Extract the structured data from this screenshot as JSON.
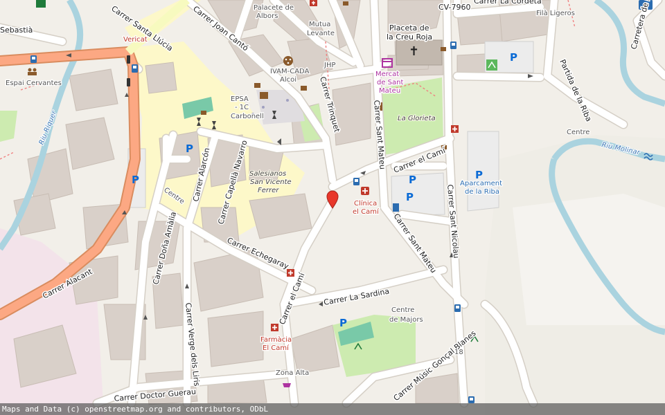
{
  "map": {
    "attribution": "Maps and Data (c) openstreetmap.org and contributors, ODbL",
    "colors": {
      "land": "#f2efe9",
      "road": "#ffffff",
      "road_casing": "#d5cfc6",
      "primary_road": "#fca883",
      "secondary_road": "#f7fabf",
      "pedestrian_area": "#fdf8c9",
      "building": "#d9d0c9",
      "park": "#cdebb0",
      "water": "#aad3df",
      "river": "#6fb8d8",
      "marker": "#e8372a"
    },
    "marker": {
      "name": "location-marker-icon"
    },
    "streets": {
      "carrer_llucia": "Carrer Santa Llúcia",
      "sebastia": "Sebastià",
      "joan_canto": "Carrer Joan Cantó",
      "trinquet": "Carrer Trinquet",
      "sant_mateu_1": "Carrer Sant Mateu",
      "sant_mateu_2": "Carrer Sant Mateu",
      "el_cami_1": "Carrer el Camí",
      "el_cami_2": "Carrer el Camí",
      "sant_nicolau": "Carrer Sant Nicolau",
      "capella_navarro": "Carrer Capellà Navarro",
      "alarcon": "Carrer Alarcón",
      "dona_amalia": "Carrer Doña Amàlia",
      "echegaray": "Carrer Echegaray",
      "verge_lliris": "Carrer Verge dels Liris",
      "la_sardina": "Carrer La Sardina",
      "doctor_guerau": "Carrer Doctor Guerau",
      "music_gonzal": "Carrer Músic Gonçal Blanes",
      "alacant": "Carrer Alacant",
      "partida_riba": "Partida de la Riba",
      "carretera": "Carretera de la Font Roja",
      "cv7960": "CV-7960",
      "la_cordeta": "Carrer La Cordeta",
      "centre_1": "Centre",
      "centre_2": "Centre"
    },
    "pois": {
      "palacete_1": "Palacete de",
      "palacete_2": "Albors",
      "mutua_1": "Mutua",
      "mutua_2": "Levante",
      "placeta_1": "Placeta de",
      "placeta_2": "la Creu Roja",
      "ivam_1": "IVAM-CADA",
      "ivam_2": "Alcoi",
      "jhp": "JHP",
      "mercat_1": "Mercat",
      "mercat_2": "de Sant",
      "mercat_3": "Mateu",
      "glorieta": "La Glorieta",
      "epsa_1": "EPSA",
      "epsa_2": "- 1C",
      "epsa_3": "Carbonell",
      "vericat": "Vericat",
      "espai": "Espai Cervantes",
      "salesianos_1": "Salesianos",
      "salesianos_2": "San Vicente",
      "salesianos_3": "Ferrer",
      "clinica_1": "Clínica",
      "clinica_2": "el Camí",
      "aparcament_1": "Aparcament",
      "aparcament_2": "de la Riba",
      "centre_majors_1": "Centre",
      "centre_majors_2": "de Majors",
      "farmacia_1": "Farmàcia",
      "farmacia_2": "El Camí",
      "zona_alta": "Zona Alta",
      "fila_ligeros": "Filà Ligeros",
      "riu_riquer": "Riu Riquer",
      "riu_molinar": "Riu Molinar",
      "house_18": "18"
    },
    "parking_symbol": "P"
  }
}
